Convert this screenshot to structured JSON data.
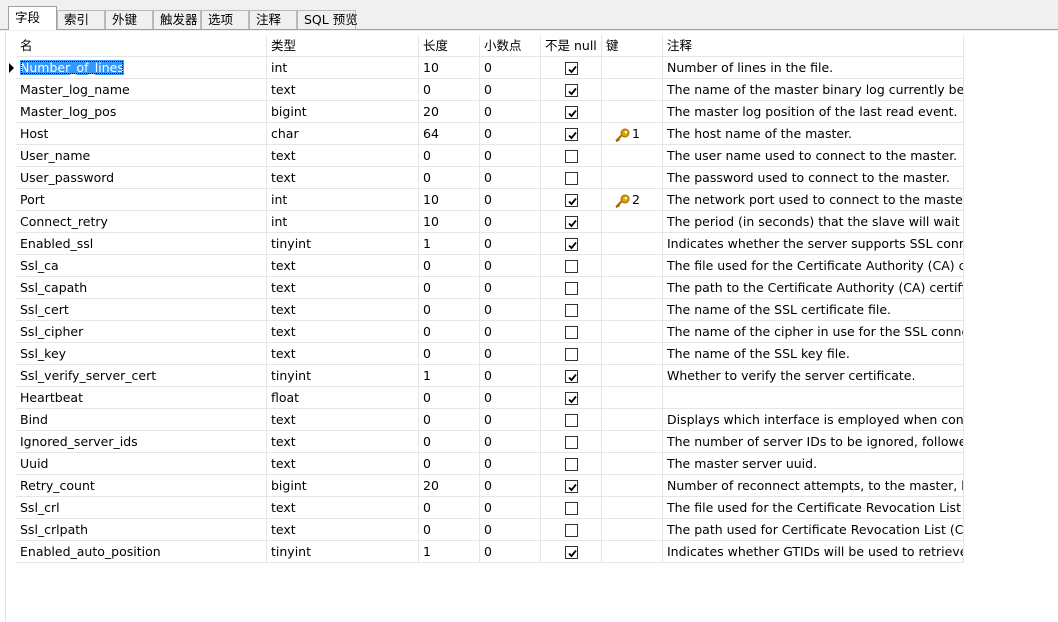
{
  "tabs": [
    "字段",
    "索引",
    "外键",
    "触发器",
    "选项",
    "注释",
    "SQL 预览"
  ],
  "active_tab": 0,
  "columns": {
    "name": "名",
    "type": "类型",
    "length": "长度",
    "decimals": "小数点",
    "not_null": "不是 null",
    "key": "键",
    "comment": "注释"
  },
  "fields": [
    {
      "name": "Number_of_lines",
      "type": "int",
      "length": "10",
      "decimals": "0",
      "not_null": true,
      "key": "",
      "comment": "Number of lines in the file."
    },
    {
      "name": "Master_log_name",
      "type": "text",
      "length": "0",
      "decimals": "0",
      "not_null": true,
      "key": "",
      "comment": "The name of the master binary log currently being"
    },
    {
      "name": "Master_log_pos",
      "type": "bigint",
      "length": "20",
      "decimals": "0",
      "not_null": true,
      "key": "",
      "comment": "The master log position of the last read event."
    },
    {
      "name": "Host",
      "type": "char",
      "length": "64",
      "decimals": "0",
      "not_null": true,
      "key": "1",
      "comment": "The host name of the master."
    },
    {
      "name": "User_name",
      "type": "text",
      "length": "0",
      "decimals": "0",
      "not_null": false,
      "key": "",
      "comment": "The user name used to connect to the master."
    },
    {
      "name": "User_password",
      "type": "text",
      "length": "0",
      "decimals": "0",
      "not_null": false,
      "key": "",
      "comment": "The password used to connect to the master."
    },
    {
      "name": "Port",
      "type": "int",
      "length": "10",
      "decimals": "0",
      "not_null": true,
      "key": "2",
      "comment": "The network port used to connect to the master."
    },
    {
      "name": "Connect_retry",
      "type": "int",
      "length": "10",
      "decimals": "0",
      "not_null": true,
      "key": "",
      "comment": "The period (in seconds) that the slave will wait befo"
    },
    {
      "name": "Enabled_ssl",
      "type": "tinyint",
      "length": "1",
      "decimals": "0",
      "not_null": true,
      "key": "",
      "comment": "Indicates whether the server supports SSL connecti"
    },
    {
      "name": "Ssl_ca",
      "type": "text",
      "length": "0",
      "decimals": "0",
      "not_null": false,
      "key": "",
      "comment": "The file used for the Certificate Authority (CA) certifi"
    },
    {
      "name": "Ssl_capath",
      "type": "text",
      "length": "0",
      "decimals": "0",
      "not_null": false,
      "key": "",
      "comment": "The path to the Certificate Authority (CA) certificates"
    },
    {
      "name": "Ssl_cert",
      "type": "text",
      "length": "0",
      "decimals": "0",
      "not_null": false,
      "key": "",
      "comment": "The name of the SSL certificate file."
    },
    {
      "name": "Ssl_cipher",
      "type": "text",
      "length": "0",
      "decimals": "0",
      "not_null": false,
      "key": "",
      "comment": "The name of the cipher in use for the SSL connectic"
    },
    {
      "name": "Ssl_key",
      "type": "text",
      "length": "0",
      "decimals": "0",
      "not_null": false,
      "key": "",
      "comment": "The name of the SSL key file."
    },
    {
      "name": "Ssl_verify_server_cert",
      "type": "tinyint",
      "length": "1",
      "decimals": "0",
      "not_null": true,
      "key": "",
      "comment": "Whether to verify the server certificate."
    },
    {
      "name": "Heartbeat",
      "type": "float",
      "length": "0",
      "decimals": "0",
      "not_null": true,
      "key": "",
      "comment": ""
    },
    {
      "name": "Bind",
      "type": "text",
      "length": "0",
      "decimals": "0",
      "not_null": false,
      "key": "",
      "comment": "Displays which interface is employed when connecti"
    },
    {
      "name": "Ignored_server_ids",
      "type": "text",
      "length": "0",
      "decimals": "0",
      "not_null": false,
      "key": "",
      "comment": "The number of server IDs to be ignored, followed b"
    },
    {
      "name": "Uuid",
      "type": "text",
      "length": "0",
      "decimals": "0",
      "not_null": false,
      "key": "",
      "comment": "The master server uuid."
    },
    {
      "name": "Retry_count",
      "type": "bigint",
      "length": "20",
      "decimals": "0",
      "not_null": true,
      "key": "",
      "comment": "Number of reconnect attempts, to the master, befo"
    },
    {
      "name": "Ssl_crl",
      "type": "text",
      "length": "0",
      "decimals": "0",
      "not_null": false,
      "key": "",
      "comment": "The file used for the Certificate Revocation List (CRL"
    },
    {
      "name": "Ssl_crlpath",
      "type": "text",
      "length": "0",
      "decimals": "0",
      "not_null": false,
      "key": "",
      "comment": "The path used for Certificate Revocation List (CRL) f"
    },
    {
      "name": "Enabled_auto_position",
      "type": "tinyint",
      "length": "1",
      "decimals": "0",
      "not_null": true,
      "key": "",
      "comment": "Indicates whether GTIDs will be used to retrieve eve"
    }
  ],
  "selected_row": 0,
  "colors": {
    "selection": "#3399ff",
    "key_icon": "#e0a000",
    "tab_bar": "#f0f0f0",
    "grid_line": "#e6e6e6"
  },
  "icons": {
    "key": "key-icon",
    "checkbox": "checkbox",
    "row_indicator": "current-row-arrow-icon"
  }
}
